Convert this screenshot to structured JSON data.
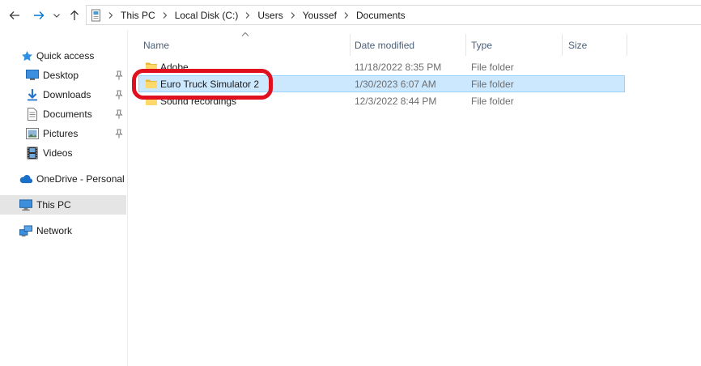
{
  "addressbar": {
    "breadcrumbs": [
      "This PC",
      "Local Disk (C:)",
      "Users",
      "Youssef",
      "Documents"
    ]
  },
  "navpane": {
    "quick_access": "Quick access",
    "desktop": "Desktop",
    "downloads": "Downloads",
    "documents": "Documents",
    "pictures": "Pictures",
    "videos": "Videos",
    "onedrive": "OneDrive - Personal",
    "this_pc": "This PC",
    "network": "Network"
  },
  "filelist": {
    "columns": {
      "name": "Name",
      "date_modified": "Date modified",
      "type": "Type",
      "size": "Size"
    },
    "rows": [
      {
        "name": "Adobe",
        "date": "11/18/2022 8:35 PM",
        "type": "File folder"
      },
      {
        "name": "Euro Truck Simulator 2",
        "date": "1/30/2023 6:07 AM",
        "type": "File folder"
      },
      {
        "name": "Sound recordings",
        "date": "12/3/2022 8:44 PM",
        "type": "File folder"
      }
    ],
    "selected_row": "Euro Truck Simulator 2"
  },
  "colors": {
    "selection_fill": "#cce8ff",
    "selection_border": "#99d1ff",
    "annotation_red": "#e0101e",
    "folder_yellow": "#ffd86b",
    "accent_blue": "#0078d7"
  }
}
